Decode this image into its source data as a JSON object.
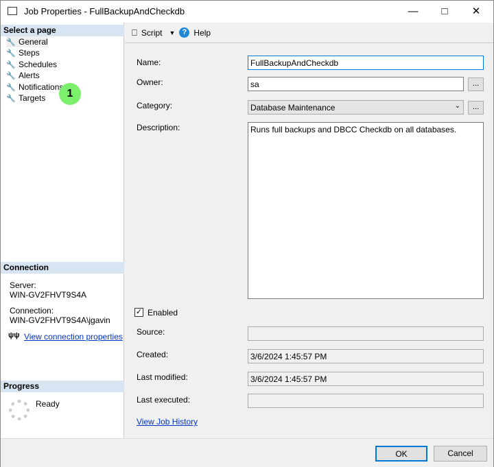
{
  "window": {
    "title": "Job Properties - FullBackupAndCheckdb"
  },
  "left": {
    "select_header": "Select a page",
    "pages": [
      "General",
      "Steps",
      "Schedules",
      "Alerts",
      "Notifications",
      "Targets"
    ],
    "annotation": "1",
    "connection_header": "Connection",
    "server_label": "Server:",
    "server_value": "WIN-GV2FHVT9S4A",
    "connection_label": "Connection:",
    "connection_value": "WIN-GV2FHVT9S4A\\jgavin",
    "view_conn_link": "View connection properties",
    "progress_header": "Progress",
    "progress_status": "Ready"
  },
  "toolbar": {
    "script": "Script",
    "help": "Help"
  },
  "form": {
    "name_label": "Name:",
    "name_value": "FullBackupAndCheckdb",
    "owner_label": "Owner:",
    "owner_value": "sa",
    "category_label": "Category:",
    "category_value": "Database Maintenance",
    "description_label": "Description:",
    "description_value": "Runs full backups and DBCC Checkdb on all databases.",
    "enabled_label": "Enabled",
    "enabled": true,
    "source_label": "Source:",
    "source_value": "",
    "created_label": "Created:",
    "created_value": "3/6/2024 1:45:57 PM",
    "modified_label": "Last modified:",
    "modified_value": "3/6/2024 1:45:57 PM",
    "executed_label": "Last executed:",
    "executed_value": "",
    "history_link": "View Job History",
    "browse": "..."
  },
  "buttons": {
    "ok": "OK",
    "cancel": "Cancel"
  },
  "colors": {
    "annotation": "#7cf06c",
    "link": "#0033cc",
    "section": "#d7e4f2"
  }
}
